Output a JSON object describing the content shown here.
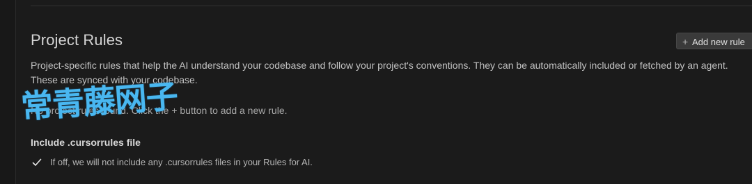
{
  "project_rules": {
    "title": "Project Rules",
    "add_button_label": "Add new rule",
    "description": "Project-specific rules that help the AI understand your codebase and follow your project's conventions. They can be automatically included or fetched by an agent. These are synced with your codebase.",
    "empty_message": "No project rules found. Click the + button to add a new rule."
  },
  "cursorrules": {
    "title": "Include .cursorrules file",
    "checked": true,
    "description": "If off, we will not include any .cursorrules files in your Rules for AI."
  },
  "watermark": {
    "text": "常青藤网子"
  },
  "colors": {
    "background": "#1b1b1b",
    "watermark": "#49b7f0",
    "button_bg": "#3a3a3a"
  }
}
